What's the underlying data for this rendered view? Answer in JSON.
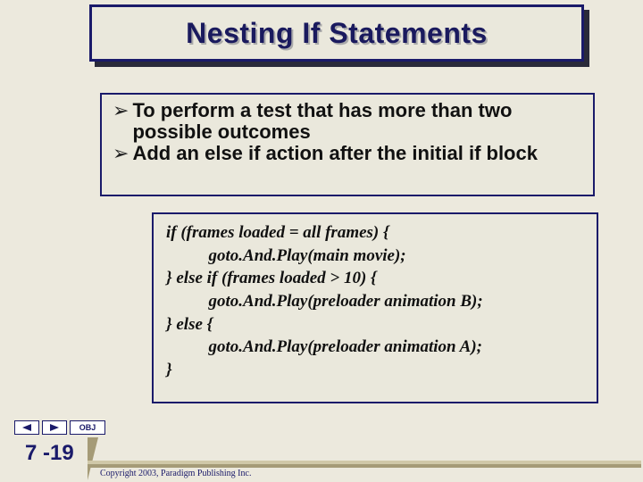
{
  "title": "Nesting If Statements",
  "bullets": [
    "To perform a test that has more than two possible outcomes",
    "Add an else if action after the initial if block"
  ],
  "code": "if (frames loaded = all frames) {\n          goto.And.Play(main movie);\n} else if (frames loaded > 10) {\n          goto.And.Play(preloader animation B);\n} else {\n          goto.And.Play(preloader animation A);\n}",
  "nav": {
    "obj_label": "OBJ"
  },
  "page_number": "7 -19",
  "copyright": "Copyright 2003, Paradigm Publishing Inc."
}
